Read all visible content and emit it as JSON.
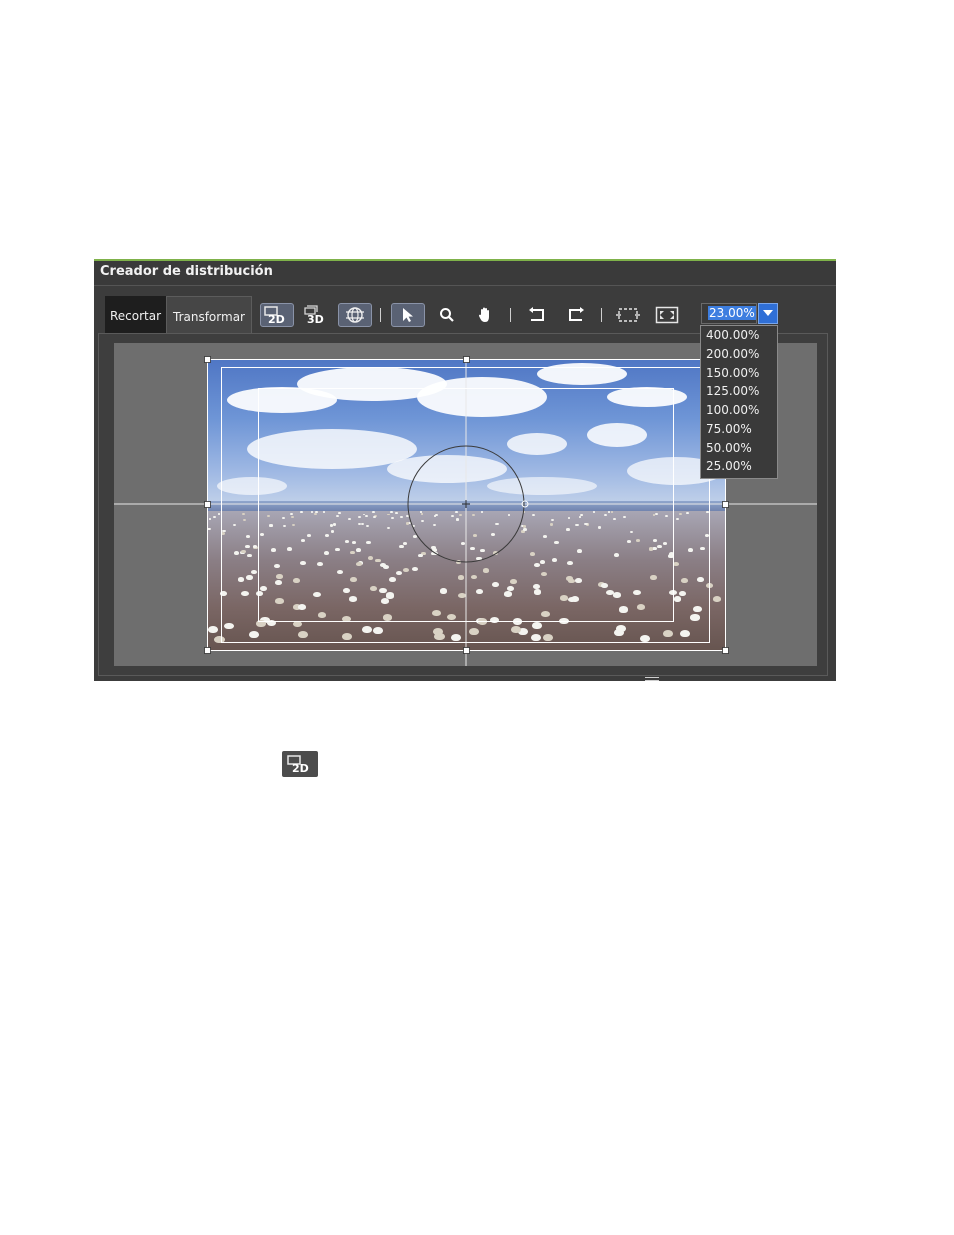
{
  "window": {
    "title": "Creador de distribución"
  },
  "tabs": [
    {
      "label": "Recortar",
      "active": false
    },
    {
      "label": "Transformar",
      "active": true
    }
  ],
  "toolbar": {
    "tools": [
      {
        "icon": "2d-mode-icon",
        "active": true
      },
      {
        "icon": "3d-mode-icon",
        "active": false
      },
      {
        "icon": "sphere-grid-icon",
        "active": true
      },
      {
        "icon": "select-arrow-icon",
        "active": true
      },
      {
        "icon": "zoom-magnifier-icon",
        "active": false
      },
      {
        "icon": "hand-pan-icon",
        "active": false
      },
      {
        "icon": "undo-icon",
        "active": false
      },
      {
        "icon": "redo-icon",
        "active": false
      },
      {
        "icon": "fit-frame-icon",
        "active": false
      },
      {
        "icon": "fullscreen-icon",
        "active": false
      }
    ],
    "zoom": {
      "value": "23.00%",
      "options": [
        "400.00%",
        "200.00%",
        "150.00%",
        "125.00%",
        "100.00%",
        "75.00%",
        "50.00%",
        "25.00%"
      ]
    }
  },
  "colors": {
    "title_accent": "#7fb24a",
    "zoom_highlight": "#3d7ee0",
    "panel_bg": "#3c3c3c",
    "canvas_bg": "#6e6e6e"
  },
  "standalone_icon": "2d-mode-icon"
}
